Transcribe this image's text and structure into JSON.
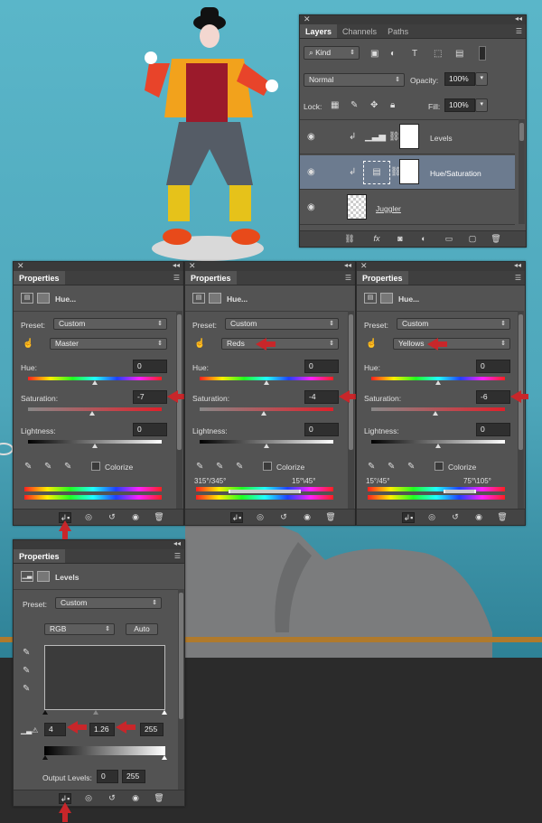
{
  "layers_panel": {
    "tabs": [
      "Layers",
      "Channels",
      "Paths"
    ],
    "kind_label": "Kind",
    "blend_mode": "Normal",
    "opacity_label": "Opacity:",
    "opacity_value": "100%",
    "lock_label": "Lock:",
    "fill_label": "Fill:",
    "fill_value": "100%",
    "layers": [
      {
        "name": "Levels",
        "selected": false
      },
      {
        "name": "Hue/Saturation",
        "selected": true
      },
      {
        "name": "Juggler",
        "selected": false
      }
    ]
  },
  "hue_panels": [
    {
      "tab": "Properties",
      "title": "Hue...",
      "preset_label": "Preset:",
      "preset_value": "Custom",
      "channel": "Master",
      "hue_label": "Hue:",
      "hue_value": "0",
      "sat_label": "Saturation:",
      "sat_value": "-7",
      "light_label": "Lightness:",
      "light_value": "0",
      "colorize_label": "Colorize",
      "range_left": "",
      "range_right": ""
    },
    {
      "tab": "Properties",
      "title": "Hue...",
      "preset_label": "Preset:",
      "preset_value": "Custom",
      "channel": "Reds",
      "hue_label": "Hue:",
      "hue_value": "0",
      "sat_label": "Saturation:",
      "sat_value": "-4",
      "light_label": "Lightness:",
      "light_value": "0",
      "colorize_label": "Colorize",
      "range_left": "315°/345°",
      "range_right": "15°\\45°"
    },
    {
      "tab": "Properties",
      "title": "Hue...",
      "preset_label": "Preset:",
      "preset_value": "Custom",
      "channel": "Yellows",
      "hue_label": "Hue:",
      "hue_value": "0",
      "sat_label": "Saturation:",
      "sat_value": "-6",
      "light_label": "Lightness:",
      "light_value": "0",
      "colorize_label": "Colorize",
      "range_left": "15°/45°",
      "range_right": "75°\\105°"
    }
  ],
  "levels_panel": {
    "tab": "Properties",
    "title": "Levels",
    "preset_label": "Preset:",
    "preset_value": "Custom",
    "channel": "RGB",
    "auto_label": "Auto",
    "input_black": "4",
    "input_gamma": "1.26",
    "input_white": "255",
    "output_label": "Output Levels:",
    "output_black": "0",
    "output_white": "255"
  },
  "colors": {
    "panel_bg": "#535353",
    "selected_layer": "#6c7b8f",
    "annotation_arrow": "#c8262a",
    "sky": "#4ea7bb"
  }
}
